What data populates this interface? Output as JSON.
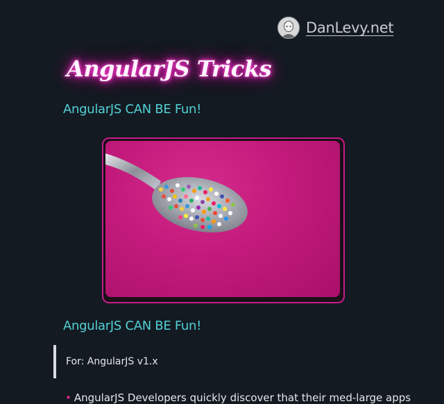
{
  "header": {
    "site_name": "DanLevy.net",
    "avatar": "author-avatar"
  },
  "article": {
    "title": "AngularJS Tricks",
    "subtitle": "AngularJS CAN BE Fun!",
    "hero_image": "spoon-of-sprinkles-image",
    "section_heading": "AngularJS CAN BE Fun!",
    "callout": "For: AngularJS v1.x",
    "list_items": [
      "AngularJS Developers quickly discover that their med-large apps"
    ]
  },
  "colors": {
    "background": "#131a21",
    "accent_cyan": "#52d1d6",
    "accent_pink": "#c81b8a",
    "title_glow": "#ff2bc8"
  }
}
